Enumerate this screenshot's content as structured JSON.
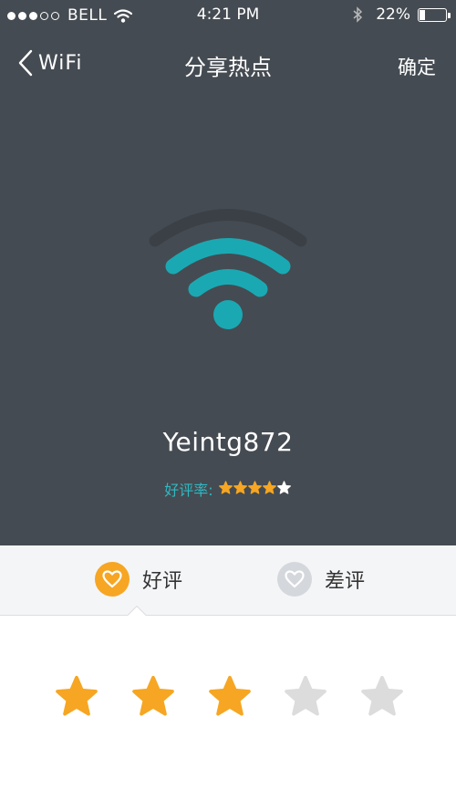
{
  "status_bar": {
    "carrier": "BELL",
    "time": "4:21 PM",
    "battery": "22%"
  },
  "nav": {
    "back_label": "WiFi",
    "title": "分享热点",
    "confirm_label": "确定"
  },
  "hotspot": {
    "ssid": "Yeintg872",
    "rating_label": "好评率:",
    "rating_stars": 4,
    "rating_max": 5
  },
  "tabs": {
    "good_label": "好评",
    "bad_label": "差评",
    "selected": "good"
  },
  "review": {
    "stars": 3,
    "max": 5
  },
  "colors": {
    "header_bg": "#454b52",
    "accent_teal": "#1aa9b3",
    "star_orange": "#f6a623",
    "star_gray": "#dcdcdc"
  }
}
